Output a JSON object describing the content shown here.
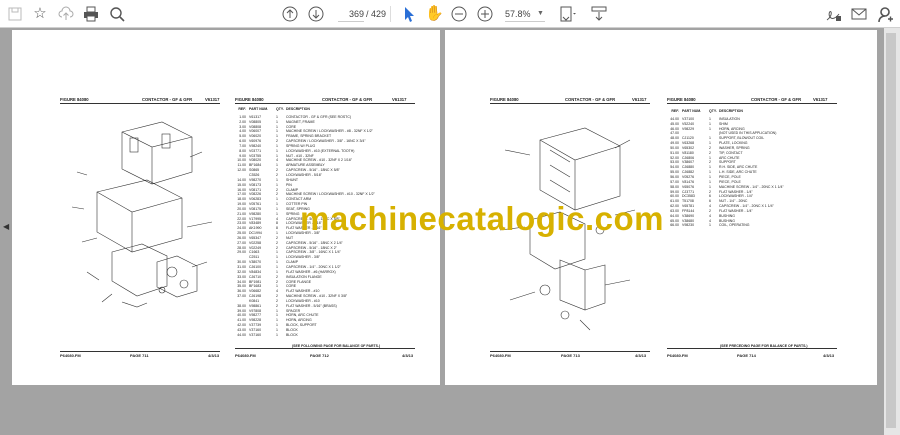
{
  "toolbar": {
    "page_current": "369",
    "page_total": "/ 429",
    "zoom": "57.8%",
    "icons": [
      "save-icon",
      "bookmark-star-icon",
      "upload-cloud-icon",
      "print-icon",
      "search-zoom-icon",
      "page-up-icon",
      "page-down-icon",
      "select-arrow-icon",
      "hand-icon",
      "zoom-out-icon",
      "zoom-in-icon",
      "page-fit-icon",
      "scroll-mode-icon",
      "sign-icon",
      "email-icon",
      "account-icon"
    ]
  },
  "watermark": "machinecatalogic.com",
  "colors": {
    "watermark": "#d7b100",
    "viewer_bg": "#a3a3a3"
  },
  "header": {
    "figure": "FIGURE 84080",
    "title": "CONTACTOR - GF & GFR",
    "code": "V61317"
  },
  "columns": {
    "ref": "REF.",
    "part": "PART NUM.",
    "qty": "QTY.",
    "desc": "DESCRIPTION"
  },
  "left_doc": {
    "footer1": {
      "file": "P64080.FM",
      "page": "PAGE 711",
      "date": "4/3/13"
    },
    "footer2": {
      "file": "P64080.FM",
      "page": "PAGE 712",
      "date": "4/3/13"
    },
    "note": "(SEE FOLLOWING PAGE FOR BALANCE OF PARTS.)",
    "parts": [
      [
        "1.00",
        "V61317",
        "1",
        "CONTACTOR - GF & GFR (SEE ROSTC)"
      ],
      [
        "2.00",
        "V08805",
        "1",
        "MAGNET, FRAME"
      ],
      [
        "3.00",
        "V08808",
        "1",
        "CORE"
      ],
      [
        "4.00",
        "V06007",
        "1",
        "MACHINE SCREW / LOCKWASHER - #8 - 32NF X 1/2\""
      ],
      [
        "5.00",
        "V06020",
        "1",
        "FRAME, SPRING BRACKET"
      ],
      [
        "6.00",
        "V60976",
        "2",
        "CAPSCREW / LOCKWASHER - 3/8\" - 16NC X 3/4\""
      ],
      [
        "7.00",
        "V98240",
        "1",
        "SPRING W/ PLUG"
      ],
      [
        "8.00",
        "V03771",
        "1",
        "LOCKWASHER - #10 (EXTERNAL TOOTH)"
      ],
      [
        "9.00",
        "V03755",
        "1",
        "NUT - #10 - 32NF"
      ],
      [
        "10.00",
        "V08020",
        "4",
        "MACHINE SCREW - #10 - 32NF X 2 1/16\""
      ],
      [
        "11.00",
        "BF1684",
        "1",
        "ARMATURE ASSEMBLY"
      ],
      [
        "12.00",
        "S0865",
        "2",
        "CAPSCREW - 5/16\" - 18NC X 5/8\""
      ],
      [
        "",
        "C3526",
        "2",
        "LOCKWASHER - 5/16\""
      ],
      [
        "14.00",
        "V98270",
        "1",
        "SHUNT"
      ],
      [
        "15.00",
        "V08173",
        "1",
        "PIN"
      ],
      [
        "16.00",
        "V08171",
        "2",
        "CLAMP"
      ],
      [
        "17.00",
        "V08226",
        "2",
        "MACHINE SCREW / LOCKWASHER - #10 - 32NF X 1/2\""
      ],
      [
        "18.00",
        "V06283",
        "1",
        "CONTACT ARM"
      ],
      [
        "19.00",
        "V05761",
        "1",
        "COTTER PIN"
      ],
      [
        "20.00",
        "V08175",
        "1",
        "SEAT, SPRING"
      ],
      [
        "21.00",
        "V98280",
        "1",
        "SPRING"
      ],
      [
        "22.00",
        "V17995",
        "4",
        "CAPSCREW - 5/16\" - 18NC X 5/8\""
      ],
      [
        "23.00",
        "V83489",
        "8",
        "LOCKWASHER - 5/16\""
      ],
      [
        "24.00",
        "AK1990",
        "8",
        "FLAT WASHER - 5/16\""
      ],
      [
        "25.00",
        "DC1994",
        "1",
        "LOCKWASHER - 3/8\""
      ],
      [
        "26.00",
        "V65347",
        "2",
        "NUT"
      ],
      [
        "27.00",
        "V02258",
        "2",
        "CAPSCREW - 5/16\" - 18NC X 2 1/4\""
      ],
      [
        "28.00",
        "V02249",
        "2",
        "CAPSCREW - 5/16\" - 18NC X 2\""
      ],
      [
        "29.00",
        "C1663",
        "1",
        "CAPSCREW - 3/8\" - 16NC X 1 1/4\""
      ],
      [
        "",
        "C2511",
        "1",
        "LOCKWASHER - 3/8\""
      ],
      [
        "30.00",
        "V38070",
        "1",
        "CLAMP"
      ],
      [
        "31.00",
        "CJ6100",
        "1",
        "CAPSCREW - 1/4\" - 20NC X 1 1/2\""
      ],
      [
        "32.00",
        "V84834",
        "1",
        "FLAT WASHER - #6 (HARROX)"
      ],
      [
        "33.00",
        "CJ6710",
        "2",
        "INSULATION FLANGE"
      ],
      [
        "34.00",
        "BF1981",
        "2",
        "CORE FLANGE"
      ],
      [
        "35.00",
        "BF1683",
        "1",
        "CORE"
      ],
      [
        "36.00",
        "V06682",
        "4",
        "FLAT WASHER - #10"
      ],
      [
        "37.00",
        "CJ6198",
        "2",
        "MACHINE SCREW - #10 - 32NF X 3/8\""
      ],
      [
        "",
        "K0841",
        "2",
        "LOCKWASHER - #10"
      ],
      [
        "38.00",
        "V98861",
        "2",
        "FLAT WASHER - 5/16\" (BRASS)"
      ],
      [
        "39.00",
        "V97808",
        "1",
        "SPACER"
      ],
      [
        "40.00",
        "V98277",
        "1",
        "HORN, ARC CHUTE"
      ],
      [
        "41.00",
        "V98228",
        "1",
        "HORN, ARCING"
      ],
      [
        "42.00",
        "V37739",
        "1",
        "BLOCK, SUPPORT"
      ],
      [
        "43.00",
        "V37160",
        "1",
        "BLOCK"
      ],
      [
        "44.00",
        "V37160",
        "1",
        "BLOCK"
      ]
    ]
  },
  "right_doc": {
    "footer1": {
      "file": "P64080.FM",
      "page": "PAGE 713",
      "date": "4/3/13"
    },
    "footer2": {
      "file": "P64080.FM",
      "page": "PAGE 714",
      "date": "4/3/13"
    },
    "note": "(SEE PRECEDING PAGE FOR BALANCE OF PARTS.)",
    "parts": [
      [
        "44.00",
        "V37100",
        "1",
        "INSULATION"
      ],
      [
        "45.00",
        "V52240",
        "1",
        "SHIM"
      ],
      [
        "46.00",
        "V98229",
        "1",
        "HORN, ARCING"
      ],
      [
        "47.00",
        "",
        "",
        "(NOT USED IN THIS APPLICATION)"
      ],
      [
        "48.00",
        "CJ1120",
        "1",
        "SUPPORT, BLOWOUT COIL"
      ],
      [
        "49.00",
        "V63268",
        "1",
        "PLATE, LOCKING"
      ],
      [
        "50.00",
        "V65302",
        "2",
        "WASHER, SPRING"
      ],
      [
        "51.00",
        "V81180",
        "2",
        "TIP, CONTACT"
      ],
      [
        "52.00",
        "CJ6806",
        "1",
        "ARC CHUTE"
      ],
      [
        "53.00",
        "V38607",
        "2",
        "SUPPORT"
      ],
      [
        "54.00",
        "CJ6880",
        "1",
        "R.H. SIDE, ARC CHUTE"
      ],
      [
        "55.00",
        "CJ6882",
        "1",
        "L.H. SIDE, ARC CHUTE"
      ],
      [
        "56.00",
        "V05276",
        "1",
        "PIECE, POLE"
      ],
      [
        "57.00",
        "V81476",
        "1",
        "PIECE, POLE"
      ],
      [
        "58.00",
        "V65076",
        "1",
        "MACHINE SCREW - 1/4\" - 20NC X 1 1/4\""
      ],
      [
        "59.00",
        "CJ3771",
        "2",
        "FLAT WASHER - 1/4\""
      ],
      [
        "60.00",
        "DC3583",
        "6",
        "LOCKWASHER - 1/4\""
      ],
      [
        "61.00",
        "T51708",
        "6",
        "NUT - 1/4\" - 20NC"
      ],
      [
        "62.00",
        "V65781",
        "4",
        "CAPSCREW - 1/4\" - 20NC X 1 1/4\""
      ],
      [
        "63.00",
        "FP8144",
        "2",
        "FLAT WASHER - 1/4\""
      ],
      [
        "64.00",
        "V38690",
        "4",
        "BUSHING"
      ],
      [
        "65.00",
        "V38680",
        "4",
        "BUSHING"
      ],
      [
        "66.00",
        "V98230",
        "1",
        "COIL, OPERATING"
      ]
    ]
  }
}
